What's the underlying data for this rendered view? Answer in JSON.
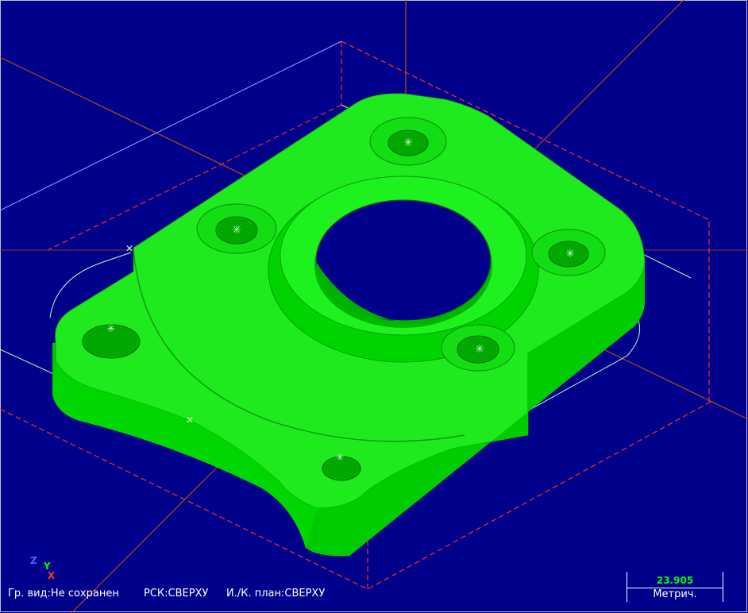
{
  "status": {
    "view": "Гр. вид:Не сохранен",
    "ucs": "РСК:СВЕРХУ",
    "plane": "И./К. план:СВЕРХУ"
  },
  "scale": {
    "value": "23.905",
    "unit": "Метрич."
  },
  "triad": {
    "z": "Z",
    "y": "Y",
    "x": "X"
  },
  "colors": {
    "background": "#00008b",
    "part": "#00ff00",
    "stock_outline": "#ff2b2b",
    "axis": "#b34a1a",
    "toolpath": "#b8ffb8"
  }
}
